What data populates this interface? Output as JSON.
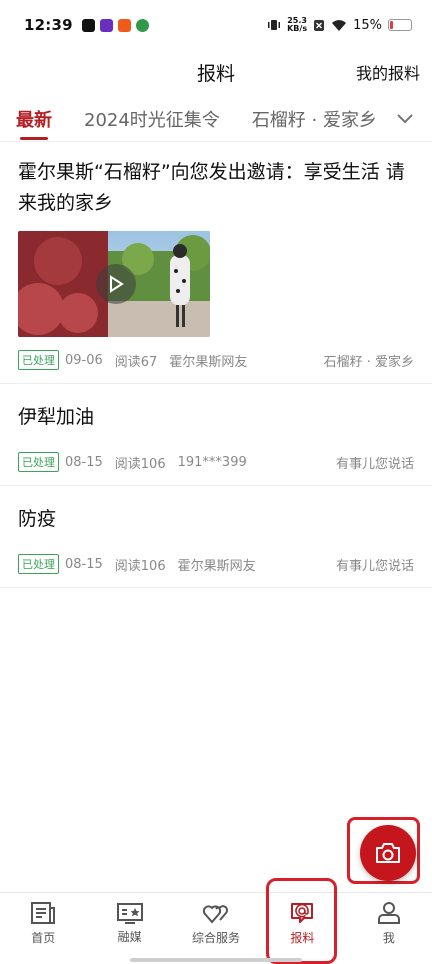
{
  "status_bar": {
    "time": "12:39",
    "net_speed_value": "25.3",
    "net_speed_unit": "KB/s",
    "battery": "15%",
    "battery_level": 0.15,
    "icons": [
      "tiktok-icon",
      "app-icon-purple",
      "app-icon-orange",
      "app-icon-green",
      "vibrate-icon",
      "no-sim-icon",
      "wifi-icon",
      "battery-icon"
    ]
  },
  "header": {
    "title": "报料",
    "right_link": "我的报料"
  },
  "tabs": [
    {
      "label": "最新",
      "active": true
    },
    {
      "label": "2024时光征集令",
      "active": false
    },
    {
      "label": "石榴籽 · 爱家乡",
      "active": false
    }
  ],
  "feed": [
    {
      "title": "霍尔果斯“石榴籽”向您发出邀请：享受生活 请来我的家乡",
      "has_video": true,
      "status": "已处理",
      "date": "09-06",
      "reads": "阅读67",
      "author": "霍尔果斯网友",
      "source": "石榴籽 · 爱家乡"
    },
    {
      "title": "伊犁加油",
      "has_video": false,
      "status": "已处理",
      "date": "08-15",
      "reads": "阅读106",
      "author": "191***399",
      "source": "有事儿您说话"
    },
    {
      "title": "防疫",
      "has_video": false,
      "status": "已处理",
      "date": "08-15",
      "reads": "阅读106",
      "author": "霍尔果斯网友",
      "source": "有事儿您说话"
    }
  ],
  "bottom_nav": [
    {
      "label": "首页",
      "icon": "newspaper-icon",
      "active": false
    },
    {
      "label": "融媒",
      "icon": "media-star-icon",
      "active": false
    },
    {
      "label": "综合服务",
      "icon": "hearts-icon",
      "active": false
    },
    {
      "label": "报料",
      "icon": "report-at-icon",
      "active": true
    },
    {
      "label": "我",
      "icon": "person-icon",
      "active": false
    }
  ],
  "colors": {
    "accent": "#b51f24",
    "fab": "#c4161c",
    "badge": "#3aa35a",
    "highlight": "#d9202a"
  }
}
